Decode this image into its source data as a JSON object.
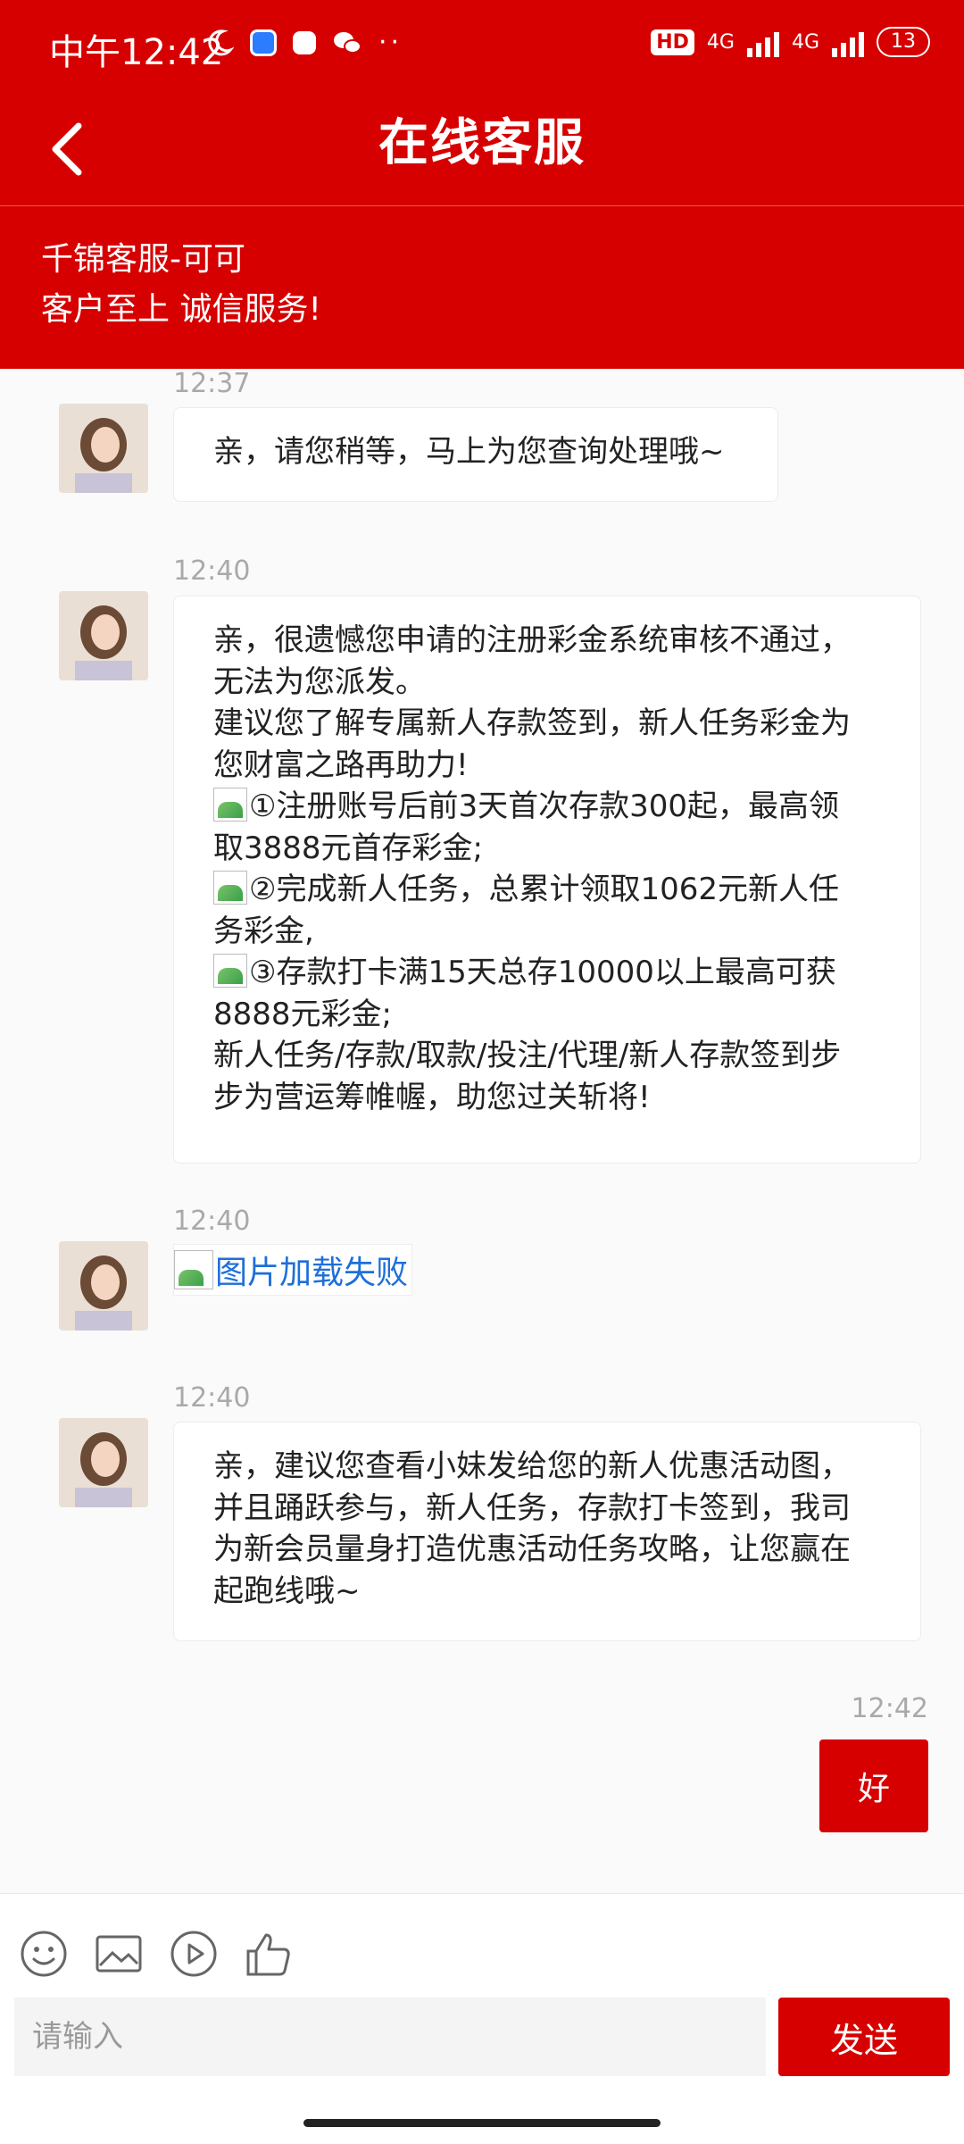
{
  "status_bar": {
    "time": "中午12:42",
    "network_1": "4G",
    "network_2": "4G",
    "battery": "13"
  },
  "header": {
    "title": "在线客服"
  },
  "agent": {
    "name": "千锦客服-可可",
    "motto": "客户至上 诚信服务!"
  },
  "messages": [
    {
      "time": "12:37",
      "lines": [
        "亲，请您稍等，马上为您查询处理哦~"
      ]
    },
    {
      "time": "12:40",
      "lines": [
        "亲，很遗憾您申请的注册彩金系统审核不通过，",
        "无法为您派发。",
        "建议您了解专属新人存款签到，新人任务彩金为",
        "您财富之路再助力!",
        "①注册账号后前3天首次存款300起，最高领",
        "取3888元首存彩金;",
        "②完成新人任务，总累计领取1062元新人任",
        "务彩金,",
        "③存款打卡满15天总存10000以上最高可获",
        "8888元彩金;",
        "新人任务/存款/取款/投注/代理/新人存款签到步",
        "步为营运筹帷幄，助您过关斩将!"
      ]
    },
    {
      "time": "12:40",
      "image_fail_text": "图片加载失败"
    },
    {
      "time": "12:40",
      "lines": [
        "亲，建议您查看小妹发给您的新人优惠活动图，",
        "并且踊跃参与，新人任务，存款打卡签到，我司",
        "为新会员量身打造优惠活动任务攻略，让您赢在",
        "起跑线哦~"
      ]
    },
    {
      "time": "12:42",
      "from_user": true,
      "text": "好"
    }
  ],
  "input": {
    "placeholder": "请输入",
    "send_label": "发送"
  },
  "toolbar": [
    "emoji-icon",
    "image-icon",
    "video-icon",
    "thumbs-up-icon"
  ],
  "colors": {
    "brand": "#d60000",
    "link": "#1e6fd9"
  }
}
